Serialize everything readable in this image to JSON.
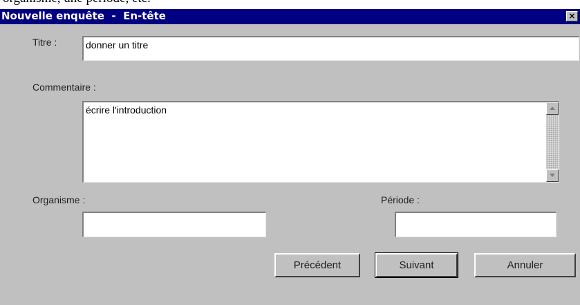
{
  "background_caption": "organisme, une période, etc.",
  "window": {
    "title": "Nouvelle enquête  -  En-tête",
    "close_glyph": "×"
  },
  "form": {
    "titre_label": "Titre :",
    "titre_value": "donner un titre",
    "commentaire_label": "Commentaire :",
    "commentaire_value": "écrire l'introduction",
    "organisme_label": "Organisme :",
    "organisme_value": "",
    "periode_label": "Période :",
    "periode_value": ""
  },
  "buttons": {
    "previous_label": "Précédent",
    "next_label": "Suivant",
    "cancel_label": "Annuler"
  }
}
